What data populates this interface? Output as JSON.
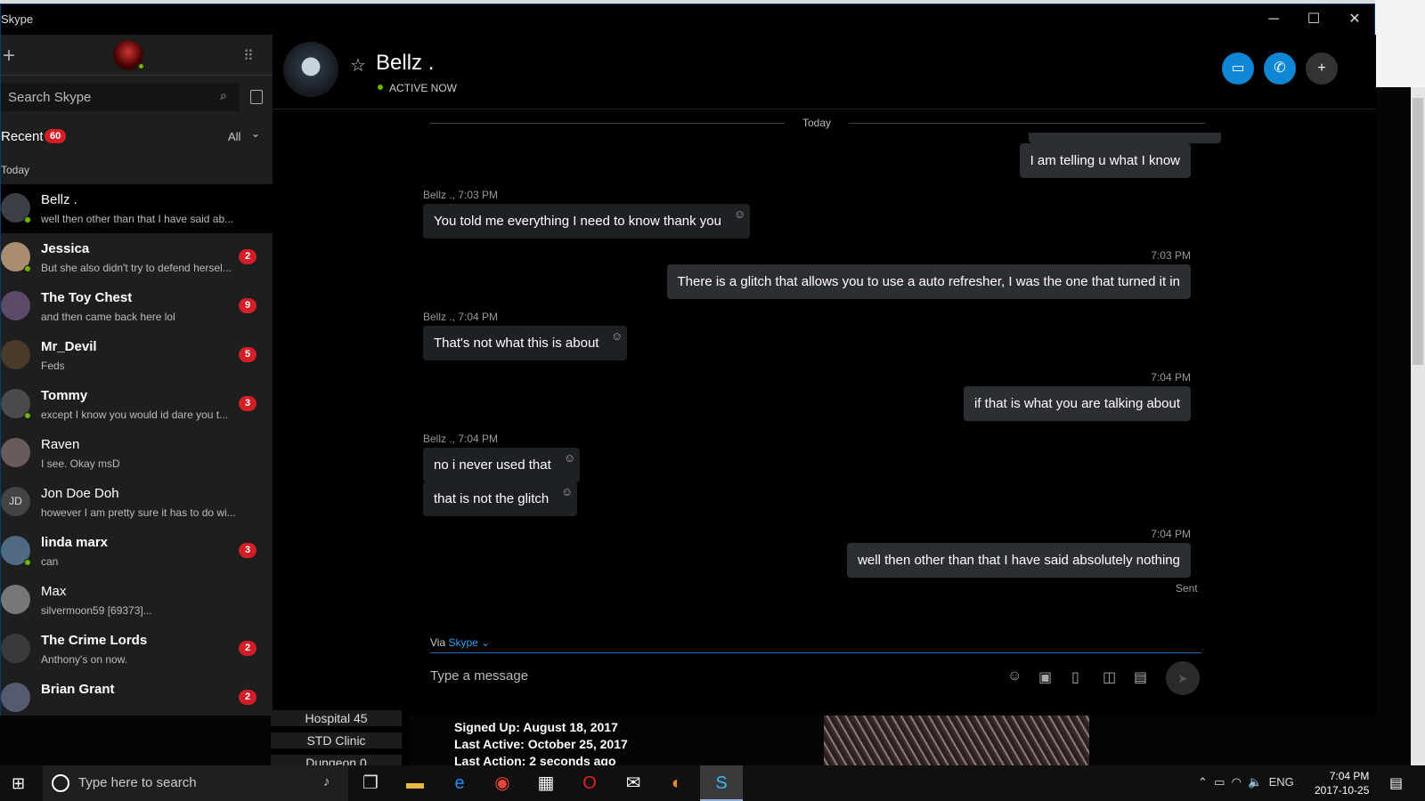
{
  "window": {
    "title": "Skype",
    "minimize": "─",
    "maximize": "☐",
    "close": "✕"
  },
  "sidebar": {
    "new_button": "+",
    "search_placeholder": "Search Skype",
    "recent_label": "Recent",
    "recent_count": "60",
    "filter_label": "All",
    "section_today": "Today",
    "contacts": [
      {
        "name": "Bellz .",
        "preview": "well then other than that I have said ab...",
        "badge": "",
        "online": true,
        "bold": false,
        "active": true,
        "initials": ""
      },
      {
        "name": "Jessica",
        "preview": "But she also didn't try to defend hersel...",
        "badge": "2",
        "online": true,
        "bold": true,
        "active": false,
        "initials": ""
      },
      {
        "name": "The Toy Chest",
        "preview": "and then came back here lol",
        "badge": "9",
        "online": false,
        "bold": true,
        "active": false,
        "initials": ""
      },
      {
        "name": "Mr_Devil",
        "preview": "Feds",
        "badge": "5",
        "online": false,
        "bold": true,
        "active": false,
        "initials": ""
      },
      {
        "name": "Tommy",
        "preview": "except I know you would id dare you t...",
        "badge": "3",
        "online": true,
        "bold": true,
        "active": false,
        "initials": ""
      },
      {
        "name": "Raven",
        "preview": "I see. Okay msD",
        "badge": "",
        "online": false,
        "bold": false,
        "active": false,
        "initials": ""
      },
      {
        "name": "Jon Doe Doh",
        "preview": "however I am pretty sure it has to do wi...",
        "badge": "",
        "online": false,
        "bold": false,
        "active": false,
        "initials": "JD"
      },
      {
        "name": "linda marx",
        "preview": "can",
        "badge": "3",
        "online": true,
        "bold": true,
        "active": false,
        "initials": ""
      },
      {
        "name": "Max",
        "preview": "silvermoon59 [69373]...",
        "badge": "",
        "online": false,
        "bold": false,
        "active": false,
        "initials": ""
      },
      {
        "name": "The Crime Lords",
        "preview": "Anthony's on now.",
        "badge": "2",
        "online": false,
        "bold": true,
        "active": false,
        "initials": ""
      },
      {
        "name": "Brian Grant",
        "preview": "",
        "badge": "2",
        "online": false,
        "bold": true,
        "active": false,
        "initials": ""
      }
    ]
  },
  "chat": {
    "peer_name": "Bellz .",
    "peer_status": "ACTIVE NOW",
    "day_divider": "Today",
    "messages": [
      {
        "dir": "out",
        "text": "I am telling u what I know",
        "meta": ""
      },
      {
        "dir": "in",
        "text": "You told me everything I need to know thank you",
        "meta": "Bellz ., 7:03 PM"
      },
      {
        "dir": "out",
        "text": "There is a glitch that allows you to use a auto refresher, I was the one that turned it in",
        "meta": "7:03 PM"
      },
      {
        "dir": "in",
        "text": "That's not what this is about",
        "meta": "Bellz ., 7:04 PM"
      },
      {
        "dir": "out",
        "text": "if that is what you are talking about",
        "meta": "7:04 PM"
      },
      {
        "dir": "in",
        "text": "no i never used that",
        "meta": "Bellz ., 7:04 PM"
      },
      {
        "dir": "in",
        "text": "that is not the glitch",
        "meta": ""
      },
      {
        "dir": "out",
        "text": "well then other than that I have said absolutely nothing",
        "meta": "7:04 PM"
      }
    ],
    "sent_status": "Sent",
    "via_label": "Via",
    "via_service": "Skype",
    "compose_placeholder": "Type a message"
  },
  "background_page": {
    "buttons": [
      "Hospital 45",
      "STD Clinic",
      "Dungeon 0"
    ],
    "signed_up": "Signed Up: August 18, 2017",
    "last_active": "Last Active: October 25, 2017",
    "last_action": "Last Action: 2 seconds ago"
  },
  "taskbar": {
    "search_placeholder": "Type here to search",
    "language": "ENG",
    "time": "7:04 PM",
    "date": "2017-10-25"
  },
  "colors": {
    "accent": "#0f86d6",
    "online": "#6bb700",
    "badge": "#d21e26"
  }
}
